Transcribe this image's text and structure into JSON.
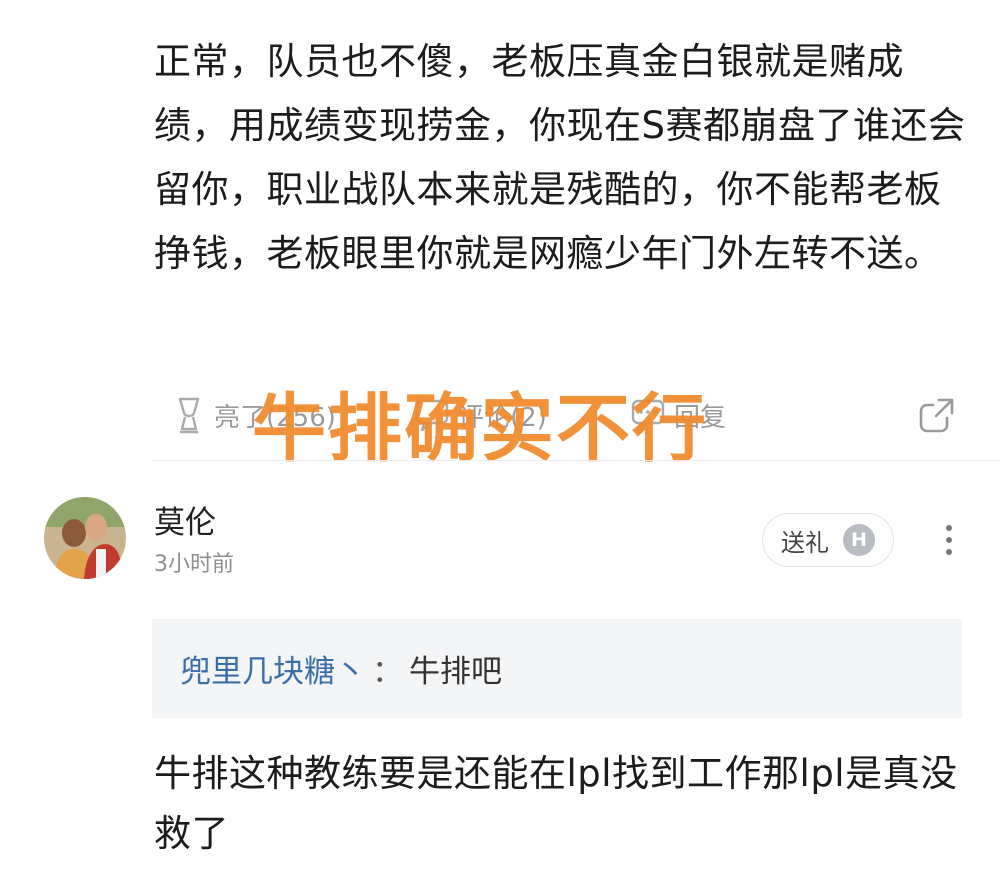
{
  "comment": {
    "text": "正常，队员也不傻，老板压真金白银就是赌成绩，用成绩变现捞金，你现在S赛都崩盘了谁还会留你，职业战队本来就是残酷的，你不能帮老板挣钱，老板眼里你就是网瘾少年门外左转不送。"
  },
  "actions": {
    "like_label": "亮了(256)",
    "comment_label": "评论(2)",
    "reply_label": "回复",
    "like_icon": "trophy-icon",
    "comment_icon": "comment-icon",
    "reply_icon": "reply-icon",
    "share_icon": "share-icon"
  },
  "overlay": {
    "title": "牛排确实不行",
    "color": "#f08a2c"
  },
  "reply_comment": {
    "username": "莫伦",
    "timestamp": "3小时前",
    "gift_label": "送礼",
    "gift_badge": "H",
    "quote_author": "兜里几块糖丶",
    "quote_separator": "：",
    "quote_text": "牛排吧",
    "text": "牛排这种教练要是还能在lpl找到工作那lpl是真没救了"
  },
  "colors": {
    "text": "#1c1c1c",
    "muted": "#9a9a9a",
    "link": "#3b6fa8",
    "quote_bg": "#f4f5f7"
  }
}
